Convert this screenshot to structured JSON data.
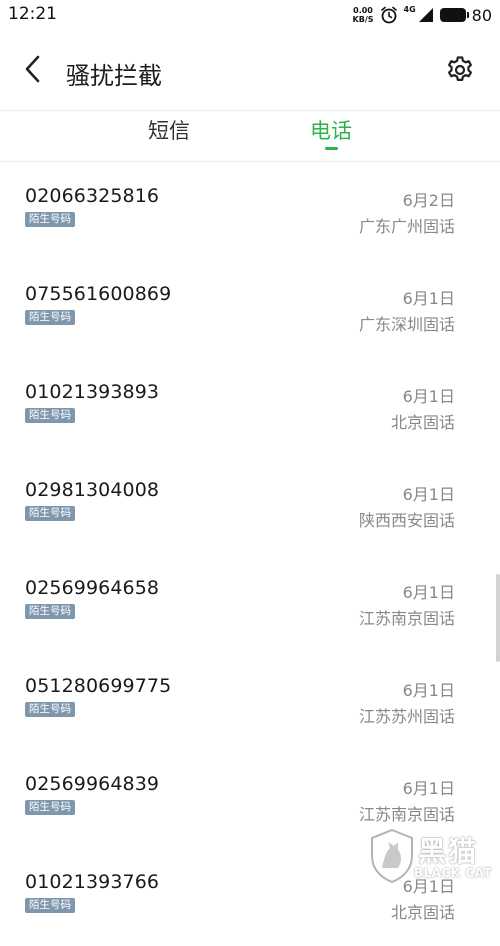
{
  "status_bar": {
    "time": "12:21",
    "net_speed_value": "0.00",
    "net_speed_unit": "KB/S",
    "signal_tag": "4G",
    "battery_level": "80"
  },
  "header": {
    "title": "骚扰拦截",
    "back_icon": "chevron-left-icon",
    "settings_icon": "gear-icon"
  },
  "tabs": [
    {
      "label": "短信",
      "active": false
    },
    {
      "label": "电话",
      "active": true
    }
  ],
  "calls": [
    {
      "number": "02066325816",
      "tag": "陌生号码",
      "date": "6月2日",
      "location": "广东广州固话"
    },
    {
      "number": "075561600869",
      "tag": "陌生号码",
      "date": "6月1日",
      "location": "广东深圳固话"
    },
    {
      "number": "01021393893",
      "tag": "陌生号码",
      "date": "6月1日",
      "location": "北京固话"
    },
    {
      "number": "02981304008",
      "tag": "陌生号码",
      "date": "6月1日",
      "location": "陕西西安固话"
    },
    {
      "number": "02569964658",
      "tag": "陌生号码",
      "date": "6月1日",
      "location": "江苏南京固话"
    },
    {
      "number": "051280699775",
      "tag": "陌生号码",
      "date": "6月1日",
      "location": "江苏苏州固话"
    },
    {
      "number": "02569964839",
      "tag": "陌生号码",
      "date": "6月1日",
      "location": "江苏南京固话"
    },
    {
      "number": "01021393766",
      "tag": "陌生号码",
      "date": "6月1日",
      "location": "北京固话"
    }
  ],
  "watermark": {
    "text_cn": "黑猫",
    "text_en": "BLACK CAT"
  },
  "colors": {
    "accent": "#2fb34c",
    "tag_bg": "#7f97ad",
    "secondary_text": "#888888"
  }
}
